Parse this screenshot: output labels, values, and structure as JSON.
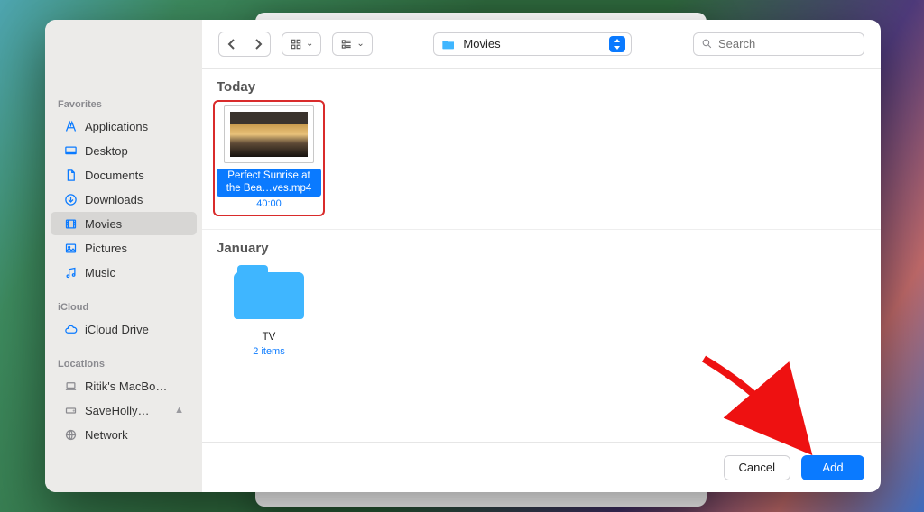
{
  "sidebar": {
    "favorites_label": "Favorites",
    "items": [
      {
        "icon": "apps-icon",
        "label": "Applications"
      },
      {
        "icon": "desktop-icon",
        "label": "Desktop"
      },
      {
        "icon": "doc-icon",
        "label": "Documents"
      },
      {
        "icon": "download-icon",
        "label": "Downloads"
      },
      {
        "icon": "movies-icon",
        "label": "Movies"
      },
      {
        "icon": "pictures-icon",
        "label": "Pictures"
      },
      {
        "icon": "music-icon",
        "label": "Music"
      }
    ],
    "icloud_label": "iCloud",
    "icloud_items": [
      {
        "icon": "cloud-icon",
        "label": "iCloud Drive"
      }
    ],
    "locations_label": "Locations",
    "locations_items": [
      {
        "icon": "laptop-icon",
        "label": "Ritik's MacBo…"
      },
      {
        "icon": "disk-icon",
        "label": "SaveHolly…",
        "eject": true
      },
      {
        "icon": "globe-icon",
        "label": "Network"
      }
    ]
  },
  "toolbar": {
    "location_label": "Movies",
    "search_placeholder": "Search"
  },
  "content": {
    "groups": [
      {
        "header": "Today",
        "items": [
          {
            "kind": "video",
            "name": "Perfect Sunrise at the Bea…ves.mp4",
            "meta": "40:00",
            "selected": true,
            "highlighted": true
          }
        ]
      },
      {
        "header": "January",
        "items": [
          {
            "kind": "folder",
            "name": "TV",
            "meta": "2 items"
          }
        ]
      }
    ]
  },
  "footer": {
    "cancel_label": "Cancel",
    "add_label": "Add"
  }
}
